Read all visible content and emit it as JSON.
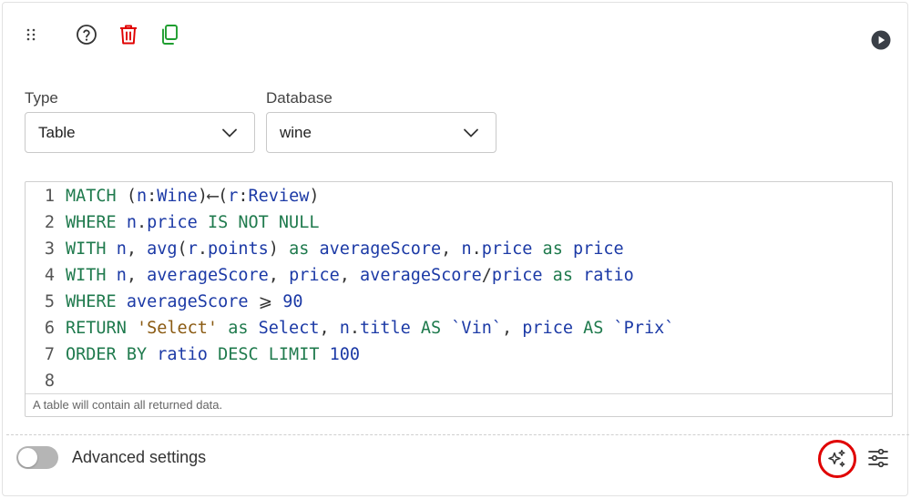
{
  "toolbar": {
    "icons": [
      "drag-handle-icon",
      "help-icon",
      "trash-icon",
      "copy-icon",
      "play-icon"
    ],
    "colors": {
      "trash": "#e00000",
      "copy": "#1e9e2f",
      "default": "#333333"
    }
  },
  "type_field": {
    "label": "Type",
    "value": "Table"
  },
  "database_field": {
    "label": "Database",
    "value": "wine"
  },
  "editor": {
    "lines": [
      {
        "number": "1",
        "tokens": [
          {
            "t": "MATCH ",
            "c": "kw"
          },
          {
            "t": "(",
            "c": "pt"
          },
          {
            "t": "n",
            "c": "id"
          },
          {
            "t": ":",
            "c": "pt"
          },
          {
            "t": "Wine",
            "c": "id"
          },
          {
            "t": ")⟵(",
            "c": "pt"
          },
          {
            "t": "r",
            "c": "id"
          },
          {
            "t": ":",
            "c": "pt"
          },
          {
            "t": "Review",
            "c": "id"
          },
          {
            "t": ")",
            "c": "pt"
          }
        ]
      },
      {
        "number": "2",
        "tokens": [
          {
            "t": "WHERE ",
            "c": "kw"
          },
          {
            "t": "n",
            "c": "id"
          },
          {
            "t": ".",
            "c": "pt"
          },
          {
            "t": "price",
            "c": "id"
          },
          {
            "t": " IS NOT NULL",
            "c": "kw"
          }
        ]
      },
      {
        "number": "3",
        "tokens": [
          {
            "t": "WITH ",
            "c": "kw"
          },
          {
            "t": "n",
            "c": "id"
          },
          {
            "t": ", ",
            "c": "pt"
          },
          {
            "t": "avg",
            "c": "id"
          },
          {
            "t": "(",
            "c": "pt"
          },
          {
            "t": "r",
            "c": "id"
          },
          {
            "t": ".",
            "c": "pt"
          },
          {
            "t": "points",
            "c": "id"
          },
          {
            "t": ") ",
            "c": "pt"
          },
          {
            "t": "as ",
            "c": "kw"
          },
          {
            "t": "averageScore",
            "c": "id"
          },
          {
            "t": ", ",
            "c": "pt"
          },
          {
            "t": "n",
            "c": "id"
          },
          {
            "t": ".",
            "c": "pt"
          },
          {
            "t": "price",
            "c": "id"
          },
          {
            "t": " as ",
            "c": "kw"
          },
          {
            "t": "price",
            "c": "id"
          }
        ]
      },
      {
        "number": "4",
        "tokens": [
          {
            "t": "WITH ",
            "c": "kw"
          },
          {
            "t": "n",
            "c": "id"
          },
          {
            "t": ", ",
            "c": "pt"
          },
          {
            "t": "averageScore",
            "c": "id"
          },
          {
            "t": ", ",
            "c": "pt"
          },
          {
            "t": "price",
            "c": "id"
          },
          {
            "t": ", ",
            "c": "pt"
          },
          {
            "t": "averageScore",
            "c": "id"
          },
          {
            "t": "/",
            "c": "pt"
          },
          {
            "t": "price",
            "c": "id"
          },
          {
            "t": " as ",
            "c": "kw"
          },
          {
            "t": "ratio",
            "c": "id"
          }
        ]
      },
      {
        "number": "5",
        "tokens": [
          {
            "t": "WHERE ",
            "c": "kw"
          },
          {
            "t": "averageScore",
            "c": "id"
          },
          {
            "t": " ⩾ ",
            "c": "pt"
          },
          {
            "t": "90",
            "c": "num"
          }
        ]
      },
      {
        "number": "6",
        "tokens": [
          {
            "t": "RETURN ",
            "c": "kw"
          },
          {
            "t": "'Select'",
            "c": "str"
          },
          {
            "t": " as ",
            "c": "kw"
          },
          {
            "t": "Select",
            "c": "id"
          },
          {
            "t": ", ",
            "c": "pt"
          },
          {
            "t": "n",
            "c": "id"
          },
          {
            "t": ".",
            "c": "pt"
          },
          {
            "t": "title",
            "c": "id"
          },
          {
            "t": " AS ",
            "c": "kw"
          },
          {
            "t": "`Vin`",
            "c": "id"
          },
          {
            "t": ", ",
            "c": "pt"
          },
          {
            "t": "price",
            "c": "id"
          },
          {
            "t": " AS ",
            "c": "kw"
          },
          {
            "t": "`Prix`",
            "c": "id"
          }
        ]
      },
      {
        "number": "7",
        "tokens": [
          {
            "t": "ORDER BY ",
            "c": "kw"
          },
          {
            "t": "ratio",
            "c": "id"
          },
          {
            "t": " DESC LIMIT ",
            "c": "kw"
          },
          {
            "t": "100",
            "c": "num"
          }
        ]
      },
      {
        "number": "8",
        "tokens": []
      }
    ],
    "hint": "A table will contain all returned data."
  },
  "footer": {
    "toggle_label": "Advanced settings",
    "toggle_on": false,
    "highlight_color": "#e00000"
  }
}
